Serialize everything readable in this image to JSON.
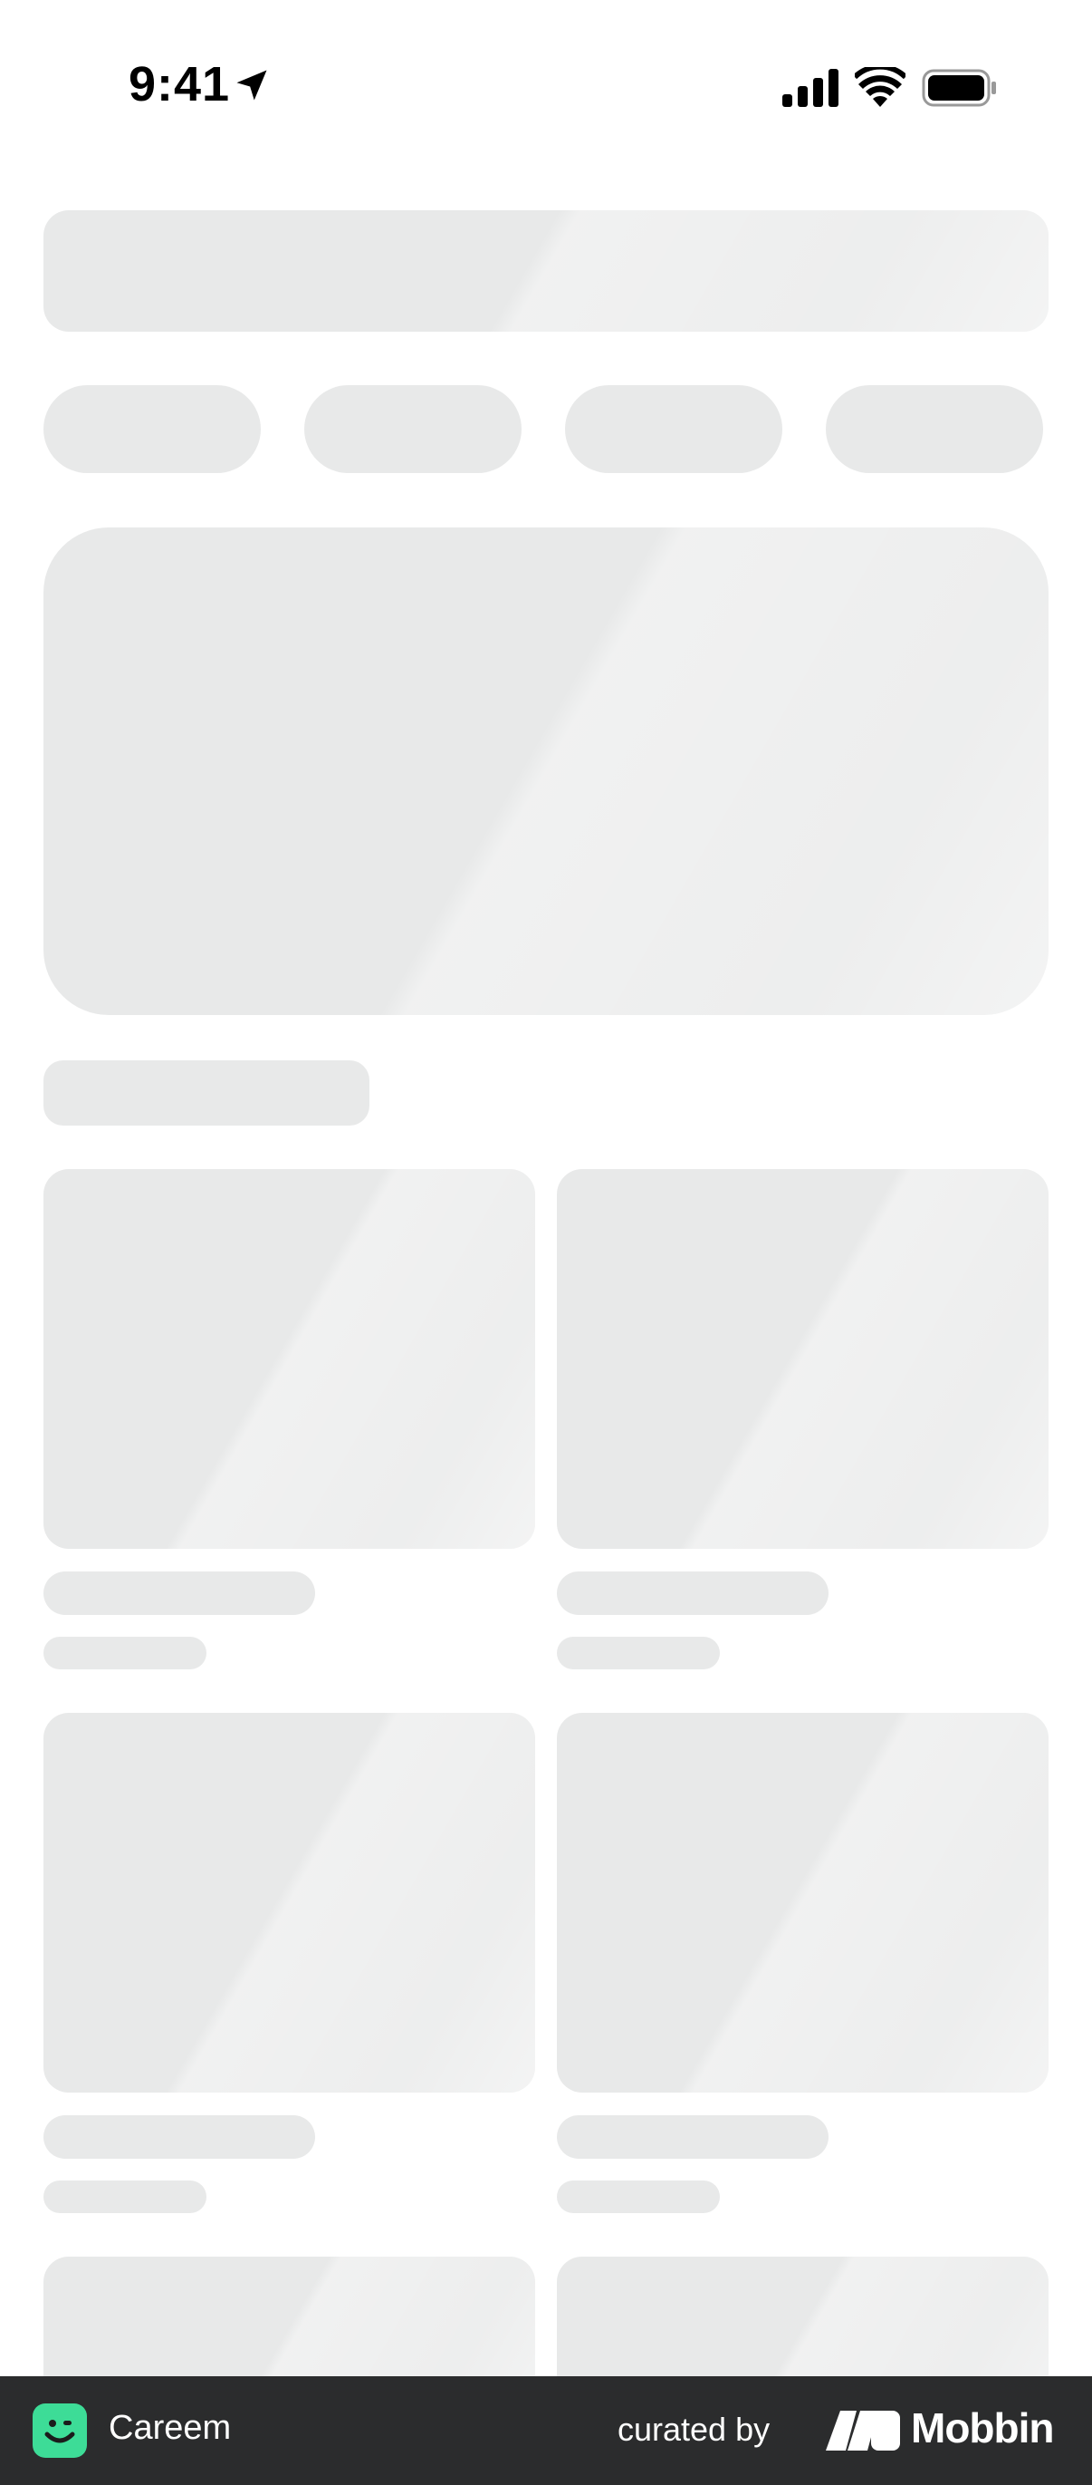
{
  "status_bar": {
    "time": "9:41",
    "icons": [
      "location-arrow-icon",
      "cellular-signal-icon",
      "wifi-icon",
      "battery-icon"
    ]
  },
  "skeleton": {
    "state": "loading",
    "filter_chip_count": 4,
    "grid_rows_visible": 3,
    "colors": {
      "placeholder": "#e8e9e9",
      "background": "#ffffff"
    }
  },
  "footer": {
    "app_name": "Careem",
    "curated_label": "curated by",
    "brand_name": "Mobbin",
    "colors": {
      "bar": "#2b2c2d",
      "app_logo": "#3ddc97"
    }
  }
}
